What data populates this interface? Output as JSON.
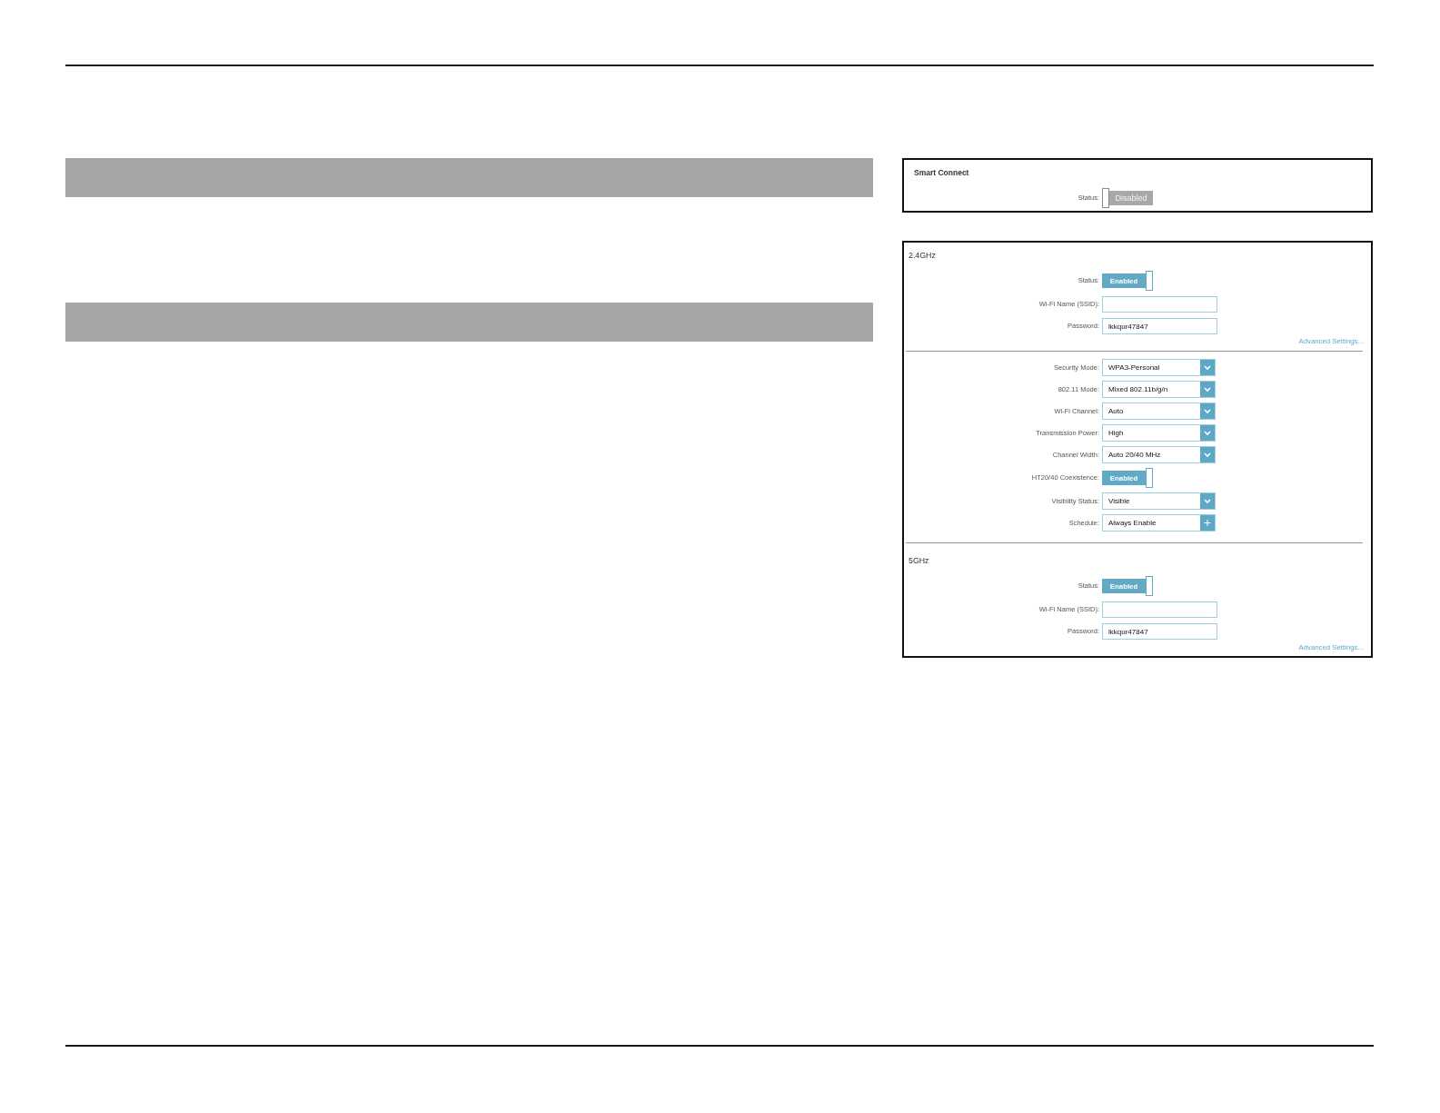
{
  "smart_connect": {
    "title": "Smart Connect",
    "status": {
      "label": "Status:",
      "text": "Disabled",
      "on": false
    }
  },
  "wireless": {
    "bands": [
      {
        "title": "2.4GHz",
        "fields": [
          {
            "kind": "toggle",
            "label": "Status:",
            "text": "Enabled",
            "on": true
          },
          {
            "kind": "input",
            "label": "Wi-Fi Name (SSID):"
          },
          {
            "kind": "input",
            "label": "Password:",
            "value": "lkkqur47847"
          }
        ],
        "link": "Advanced Settings...",
        "settings": [
          {
            "kind": "select",
            "label": "Security Mode:",
            "value": "WPA3-Personal"
          },
          {
            "kind": "select",
            "label": "802.11 Mode:",
            "value": "Mixed 802.11b/g/n"
          },
          {
            "kind": "select",
            "label": "Wi-Fi Channel:",
            "value": "Auto"
          },
          {
            "kind": "select",
            "label": "Transmission Power:",
            "value": "High"
          },
          {
            "kind": "select",
            "label": "Channel Width:",
            "value": "Auto 20/40 MHz"
          },
          {
            "kind": "toggle",
            "label": "HT20/40 Coexistence:",
            "text": "Enabled",
            "on": true
          },
          {
            "kind": "select",
            "label": "Visibility Status:",
            "value": "Visible"
          },
          {
            "kind": "schedule",
            "label": "Schedule:",
            "value": "Always Enable"
          }
        ]
      },
      {
        "title": "5GHz",
        "fields": [
          {
            "kind": "toggle",
            "label": "Status:",
            "text": "Enabled",
            "on": true
          },
          {
            "kind": "input",
            "label": "Wi-Fi Name (SSID):"
          },
          {
            "kind": "input",
            "label": "Password:",
            "value": "lkkqur47847"
          }
        ],
        "link": "Advanced Settings..."
      }
    ]
  }
}
